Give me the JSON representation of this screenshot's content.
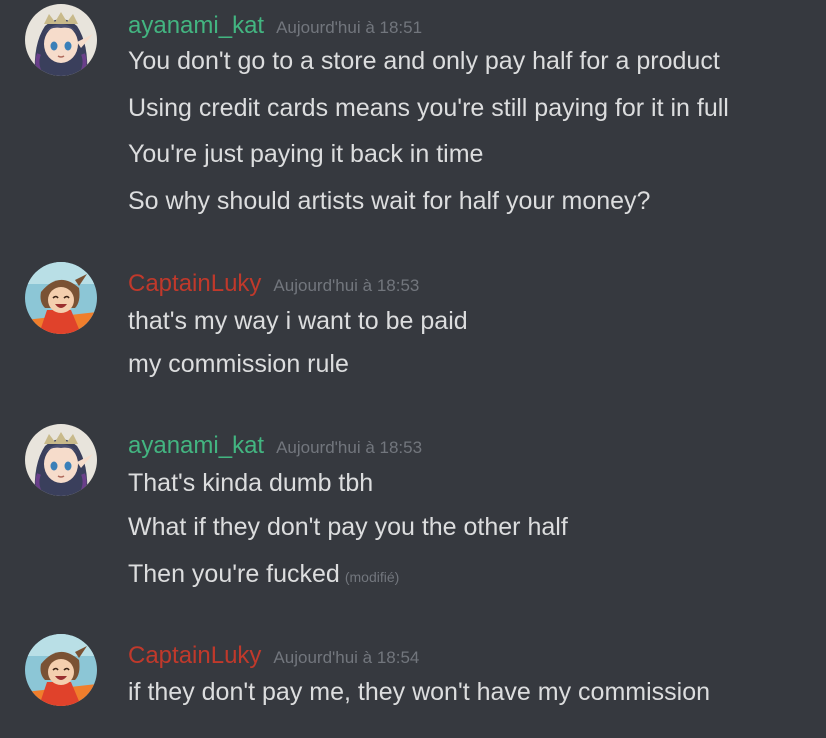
{
  "colors": {
    "background": "#36393f",
    "text": "#dcddde",
    "muted": "#72767d",
    "ayanami_color": "#43b581",
    "luky_color": "#c0392b"
  },
  "messages": [
    {
      "author": "ayanami_kat",
      "timestamp": "Aujourd'hui à 18:51",
      "avatar_icon": "elf-girl-avatar",
      "lines": [
        "You don't go to a store and only pay half for a product",
        "Using credit cards means you're still paying for it in full",
        "You're just paying it back in time",
        "So why should artists wait for half your money?"
      ]
    },
    {
      "author": "CaptainLuky",
      "timestamp": "Aujourd'hui à 18:53",
      "avatar_icon": "laughing-girl-avatar",
      "lines": [
        "that's my way i want to be paid",
        "my commission rule"
      ]
    },
    {
      "author": "ayanami_kat",
      "timestamp": "Aujourd'hui à 18:53",
      "avatar_icon": "elf-girl-avatar",
      "lines": [
        "That's kinda dumb tbh",
        "What if they don't pay you the other half",
        "Then you're fucked"
      ],
      "edited_label": "(modifié)"
    },
    {
      "author": "CaptainLuky",
      "timestamp": "Aujourd'hui à 18:54",
      "avatar_icon": "laughing-girl-avatar",
      "lines": [
        "if they don't pay me, they won't have my commission"
      ]
    }
  ]
}
